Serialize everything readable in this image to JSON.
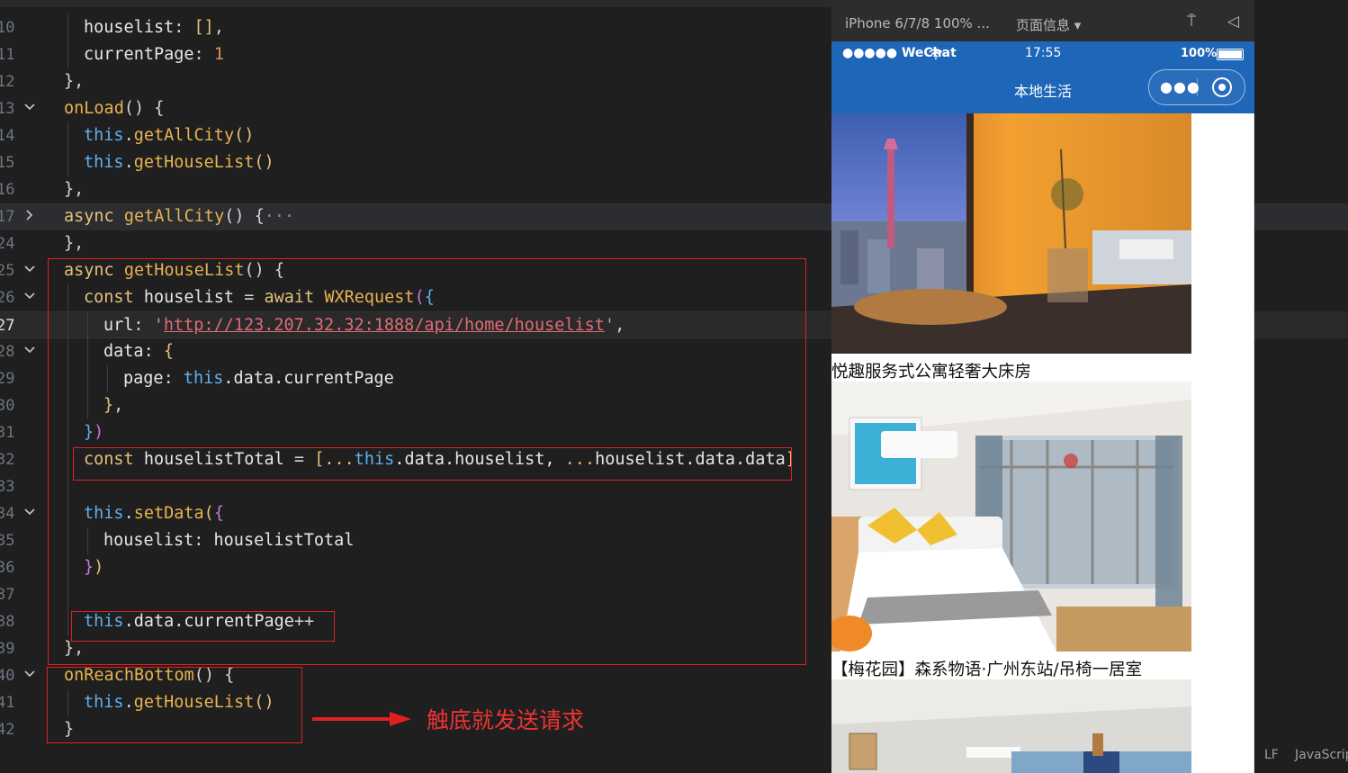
{
  "editor": {
    "lines": [
      {
        "no": "10",
        "fold": "",
        "tokens": [
          {
            "t": "housel",
            "c": "prop"
          },
          {
            "t": "ist",
            "c": "prop"
          },
          {
            "t": ": ",
            "c": "op"
          },
          {
            "t": "[]",
            "c": "br1"
          },
          {
            "t": ",",
            "c": "op"
          }
        ]
      },
      {
        "no": "11",
        "fold": "",
        "tokens": [
          {
            "t": "currentPage",
            "c": "prop"
          },
          {
            "t": ": ",
            "c": "op"
          },
          {
            "t": "1",
            "c": "num"
          }
        ]
      },
      {
        "no": "12",
        "fold": "",
        "tokens": [
          {
            "t": "},",
            "c": "op"
          }
        ]
      },
      {
        "no": "13",
        "fold": "open",
        "tokens": [
          {
            "t": "onLoad",
            "c": "fn"
          },
          {
            "t": "() {",
            "c": "op"
          }
        ]
      },
      {
        "no": "14",
        "fold": "",
        "tokens": [
          {
            "t": "this",
            "c": "this"
          },
          {
            "t": ".",
            "c": "op"
          },
          {
            "t": "getAllCity",
            "c": "fn"
          },
          {
            "t": "()",
            "c": "br1"
          }
        ]
      },
      {
        "no": "15",
        "fold": "",
        "tokens": [
          {
            "t": "this",
            "c": "this"
          },
          {
            "t": ".",
            "c": "op"
          },
          {
            "t": "getHouseList",
            "c": "fn"
          },
          {
            "t": "()",
            "c": "br1"
          }
        ]
      },
      {
        "no": "16",
        "fold": "",
        "tokens": [
          {
            "t": "},",
            "c": "op"
          }
        ]
      },
      {
        "no": "17",
        "fold": "closed",
        "tokens": [
          {
            "t": "async ",
            "c": "k"
          },
          {
            "t": "getAllCity",
            "c": "fn"
          },
          {
            "t": "() {",
            "c": "op"
          },
          {
            "t": "···",
            "c": "dim"
          }
        ]
      },
      {
        "no": "24",
        "fold": "",
        "tokens": [
          {
            "t": "},",
            "c": "op"
          }
        ]
      },
      {
        "no": "25",
        "fold": "open",
        "tokens": [
          {
            "t": "async ",
            "c": "k"
          },
          {
            "t": "getHouseList",
            "c": "fn"
          },
          {
            "t": "() {",
            "c": "op"
          }
        ]
      },
      {
        "no": "26",
        "fold": "open",
        "tokens": [
          {
            "t": "const ",
            "c": "k"
          },
          {
            "t": "houselist",
            "c": "prop"
          },
          {
            "t": " = ",
            "c": "op"
          },
          {
            "t": "await ",
            "c": "k"
          },
          {
            "t": "WXRequest",
            "c": "fn"
          },
          {
            "t": "(",
            "c": "br2"
          },
          {
            "t": "{",
            "c": "br3"
          }
        ]
      },
      {
        "no": "27",
        "fold": "",
        "tokens": [
          {
            "t": "url",
            "c": "prop"
          },
          {
            "t": ": ",
            "c": "op"
          },
          {
            "t": "'",
            "c": "str"
          },
          {
            "t": "http://123.207.32.32:1888/api/home/houselist",
            "c": "url"
          },
          {
            "t": "'",
            "c": "str"
          },
          {
            "t": ",",
            "c": "op"
          }
        ]
      },
      {
        "no": "28",
        "fold": "open",
        "tokens": [
          {
            "t": "data",
            "c": "prop"
          },
          {
            "t": ": ",
            "c": "op"
          },
          {
            "t": "{",
            "c": "br1"
          }
        ]
      },
      {
        "no": "29",
        "fold": "",
        "tokens": [
          {
            "t": "page",
            "c": "prop"
          },
          {
            "t": ": ",
            "c": "op"
          },
          {
            "t": "this",
            "c": "this"
          },
          {
            "t": ".data.currentPage",
            "c": "prop"
          }
        ]
      },
      {
        "no": "30",
        "fold": "",
        "tokens": [
          {
            "t": "}",
            "c": "br1"
          },
          {
            "t": ",",
            "c": "op"
          }
        ]
      },
      {
        "no": "31",
        "fold": "",
        "tokens": [
          {
            "t": "}",
            "c": "br3"
          },
          {
            "t": ")",
            "c": "br2"
          }
        ]
      },
      {
        "no": "32",
        "fold": "",
        "tokens": [
          {
            "t": "const ",
            "c": "k"
          },
          {
            "t": "houselistTotal",
            "c": "prop"
          },
          {
            "t": " = ",
            "c": "op"
          },
          {
            "t": "[...",
            "c": "br1"
          },
          {
            "t": "this",
            "c": "this"
          },
          {
            "t": ".data.houselist, ",
            "c": "prop"
          },
          {
            "t": "...",
            "c": "br1"
          },
          {
            "t": "houselist.data.data",
            "c": "prop"
          },
          {
            "t": "]",
            "c": "br1"
          }
        ]
      },
      {
        "no": "33",
        "fold": "",
        "tokens": []
      },
      {
        "no": "34",
        "fold": "open",
        "tokens": [
          {
            "t": "this",
            "c": "this"
          },
          {
            "t": ".",
            "c": "op"
          },
          {
            "t": "setData",
            "c": "fn"
          },
          {
            "t": "(",
            "c": "br1"
          },
          {
            "t": "{",
            "c": "br2"
          }
        ]
      },
      {
        "no": "35",
        "fold": "",
        "tokens": [
          {
            "t": "houselist",
            "c": "prop"
          },
          {
            "t": ": ",
            "c": "op"
          },
          {
            "t": "houselistTotal",
            "c": "prop"
          }
        ]
      },
      {
        "no": "36",
        "fold": "",
        "tokens": [
          {
            "t": "}",
            "c": "br2"
          },
          {
            "t": ")",
            "c": "br1"
          }
        ]
      },
      {
        "no": "37",
        "fold": "",
        "tokens": []
      },
      {
        "no": "38",
        "fold": "",
        "tokens": [
          {
            "t": "this",
            "c": "this"
          },
          {
            "t": ".data.currentPage",
            "c": "prop"
          },
          {
            "t": "++",
            "c": "op"
          }
        ]
      },
      {
        "no": "39",
        "fold": "",
        "tokens": [
          {
            "t": "},",
            "c": "op"
          }
        ]
      },
      {
        "no": "40",
        "fold": "open",
        "tokens": [
          {
            "t": "onReachBottom",
            "c": "fn"
          },
          {
            "t": "() {",
            "c": "op"
          }
        ]
      },
      {
        "no": "41",
        "fold": "",
        "tokens": [
          {
            "t": "this",
            "c": "this"
          },
          {
            "t": ".",
            "c": "op"
          },
          {
            "t": "getHouseList",
            "c": "fn"
          },
          {
            "t": "()",
            "c": "br1"
          }
        ]
      },
      {
        "no": "42",
        "fold": "",
        "tokens": [
          {
            "t": "}",
            "c": "op"
          }
        ]
      }
    ],
    "annotation": "触底就发送请求",
    "accent_red": "#e02020"
  },
  "simulator": {
    "device": "iPhone 6/7/8 100% ...",
    "page_info": "页面信息 ▾",
    "status": {
      "carrier": "●●●●● WeChat",
      "time": "17:55",
      "battery": "100%"
    },
    "nav_title": "本地生活",
    "nav_color": "#1e66b8",
    "houses": [
      {
        "title": "悦趣服务式公寓轻奢大床房"
      },
      {
        "title": "【梅花园】森系物语·广州东站/吊椅一居室"
      },
      {
        "title": ""
      }
    ]
  },
  "statusbar": {
    "eol": "LF",
    "language": "JavaScrip"
  }
}
